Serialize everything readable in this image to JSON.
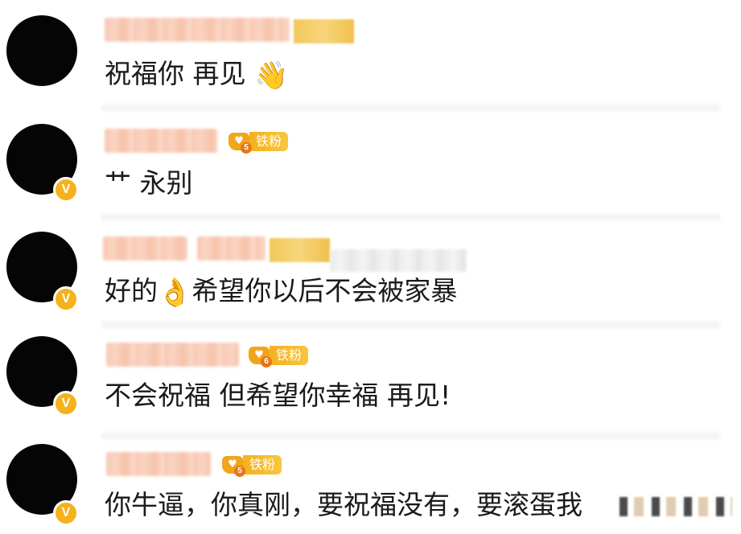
{
  "comments": [
    {
      "text": "祝福你 再见",
      "emoji": "👋",
      "emoji_name": "waving-hand",
      "verified": false,
      "fan_badge": null
    },
    {
      "text": "艹 永别",
      "verified": true,
      "fan_badge": {
        "level": "5",
        "label": "铁粉"
      }
    },
    {
      "text_before_emoji": "好的",
      "emoji": "👌",
      "emoji_name": "ok-hand",
      "text_after_emoji": "希望你以后不会被家暴",
      "verified": true,
      "fan_badge": null
    },
    {
      "text": "不会祝福 但希望你幸福 再见!",
      "verified": true,
      "fan_badge": {
        "level": "6",
        "label": "铁粉"
      }
    },
    {
      "text": "你牛逼，你真刚，要祝福没有，要滚蛋我",
      "verified": true,
      "fan_badge": {
        "level": "5",
        "label": "铁粉"
      }
    }
  ],
  "verified_badge_glyph": "V",
  "colors": {
    "avatar": "#050505",
    "verified_badge": "#f5b21b",
    "fan_badge": "#f5b01e",
    "text": "#1a1a1a"
  }
}
